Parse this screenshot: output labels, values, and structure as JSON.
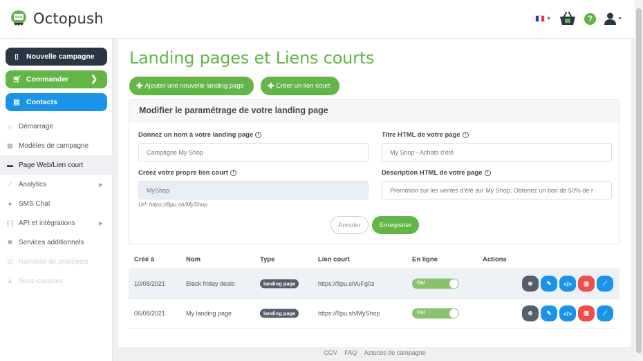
{
  "app": {
    "name": "Octopush"
  },
  "header": {
    "language": "FR",
    "flag_colors": [
      "#1f3f9a",
      "#ffffff",
      "#e63a3a"
    ],
    "icons": [
      "basket-icon",
      "help-icon",
      "user-icon"
    ],
    "help_glyph": "?"
  },
  "colors": {
    "accent_green": "#62b546",
    "accent_blue": "#1b93e9",
    "dark": "#2b3645",
    "danger": "#ef4e4e"
  },
  "sidebar": {
    "cta": [
      {
        "label": "Nouvelle campagne",
        "icon": "mobile-icon"
      },
      {
        "label": "Commander",
        "icon": "cart-icon"
      },
      {
        "label": "Contacts",
        "icon": "contacts-icon"
      }
    ],
    "items": [
      {
        "label": "Démarrage",
        "icon": "home-icon"
      },
      {
        "label": "Modèles de campagne",
        "icon": "template-icon"
      },
      {
        "label": "Page Web/Lien court",
        "icon": "card-icon"
      },
      {
        "label": "Analytics",
        "icon": "chart-icon"
      },
      {
        "label": "SMS Chat",
        "icon": "chat-icon"
      },
      {
        "label": "API et intégrations",
        "icon": "code-icon"
      },
      {
        "label": "Services additionnels",
        "icon": "tools-icon"
      },
      {
        "label": "Numéros de prospects",
        "icon": "list-icon"
      },
      {
        "label": "Sous-comptes",
        "icon": "users-icon"
      }
    ]
  },
  "main": {
    "title": "Landing pages et Liens courts",
    "add_landing_label": "Ajouter une nouvelle landing page",
    "add_link_label": "Créer un lien court",
    "form": {
      "heading": "Modifier le paramétrage de votre landing page",
      "name_label": "Donnez un nom à votre landing page",
      "name_value": "Campagne My Shop",
      "html_title_label": "Titre HTML de votre page",
      "html_title_value": "My Shop - Achats d'été",
      "short_link_label": "Créez votre propre lien court",
      "short_link_value": "MyShop",
      "url_hint": "Url: https://8pu.sh/MyShop",
      "html_desc_label": "Description HTML de votre page",
      "html_desc_value": "Promotion sur les ventes d'été sur My Shop. Obtenez un bon de 50% de r",
      "cancel_label": "Annuler",
      "save_label": "Enregistrer"
    },
    "table": {
      "columns": [
        "Créé à",
        "Nom",
        "Type",
        "Lien court",
        "En ligne",
        "Actions"
      ],
      "rows": [
        {
          "created": "10/08/2021",
          "name": "Black friday deals",
          "type": "landing page",
          "link": "https://8pu.sh/uFg0z",
          "online": "Oui"
        },
        {
          "created": "06/08/2021",
          "name": "My landing page",
          "type": "landing page",
          "link": "https://8pu.sh/MyShop",
          "online": "Oui"
        }
      ]
    }
  },
  "footer": {
    "links": [
      "CGV",
      "FAQ",
      "Astuces de campagne"
    ]
  }
}
